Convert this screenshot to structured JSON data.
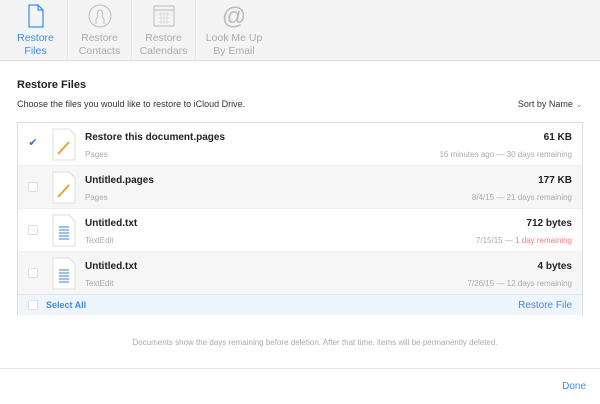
{
  "toolbar": {
    "tabs": [
      {
        "label1": "Restore",
        "label2": "Files",
        "icon": "document-icon"
      },
      {
        "label1": "Restore",
        "label2": "Contacts",
        "icon": "contact-icon"
      },
      {
        "label1": "Restore",
        "label2": "Calendars",
        "icon": "calendar-icon"
      },
      {
        "label1": "Look Me Up",
        "label2": "By Email",
        "icon": "at-icon"
      }
    ]
  },
  "page": {
    "title": "Restore Files",
    "subtitle": "Choose the files you would like to restore to iCloud Drive.",
    "sort": "Sort by Name"
  },
  "files": [
    {
      "name": "Restore this document.pages",
      "app": "Pages",
      "size": "61 KB",
      "date": "16 minutes ago",
      "remaining": "30 days remaining",
      "checked": true
    },
    {
      "name": "Untitled.pages",
      "app": "Pages",
      "size": "177 KB",
      "date": "8/4/15",
      "remaining": "21 days remaining",
      "checked": false
    },
    {
      "name": "Untitled.txt",
      "app": "TextEdit",
      "size": "712 bytes",
      "date": "7/15/15",
      "remaining": "1 day remaining",
      "checked": false
    },
    {
      "name": "Untitled.txt",
      "app": "TextEdit",
      "size": "4 bytes",
      "date": "7/26/15",
      "remaining": "12 days remaining",
      "checked": false
    }
  ],
  "footer": {
    "select_all": "Select All",
    "restore": "Restore File"
  },
  "note": "Documents show the days remaining before deletion. After that time, items will be permanently deleted.",
  "done": "Done",
  "colors": {
    "accent": "#3a8ee6",
    "warning": "#ef7f7f"
  }
}
